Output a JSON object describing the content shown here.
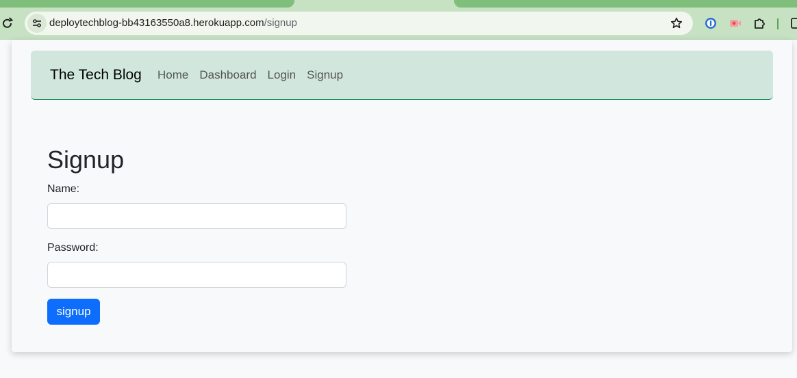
{
  "browser": {
    "url_host": "deploytechblog-bb43163550a8.herokuapp.com",
    "url_path": "/signup",
    "colors": {
      "tab_active": "#7fbf7b",
      "toolbar": "#c7e2c2",
      "omnibox": "#f1f7ef"
    }
  },
  "navbar": {
    "brand": "The Tech Blog",
    "links": [
      "Home",
      "Dashboard",
      "Login",
      "Signup"
    ],
    "colors": {
      "background": "#d1e7dd",
      "border": "#198754"
    }
  },
  "form": {
    "title": "Signup",
    "name_label": "Name:",
    "name_value": "",
    "password_label": "Password:",
    "password_value": "",
    "submit_label": "signup",
    "colors": {
      "button": "#0d6efd"
    }
  },
  "icons": [
    "reload-icon",
    "site-info-icon",
    "bookmark-star-icon",
    "password-manager-extension-icon",
    "media-extension-icon",
    "extensions-puzzle-icon",
    "side-panel-icon"
  ]
}
